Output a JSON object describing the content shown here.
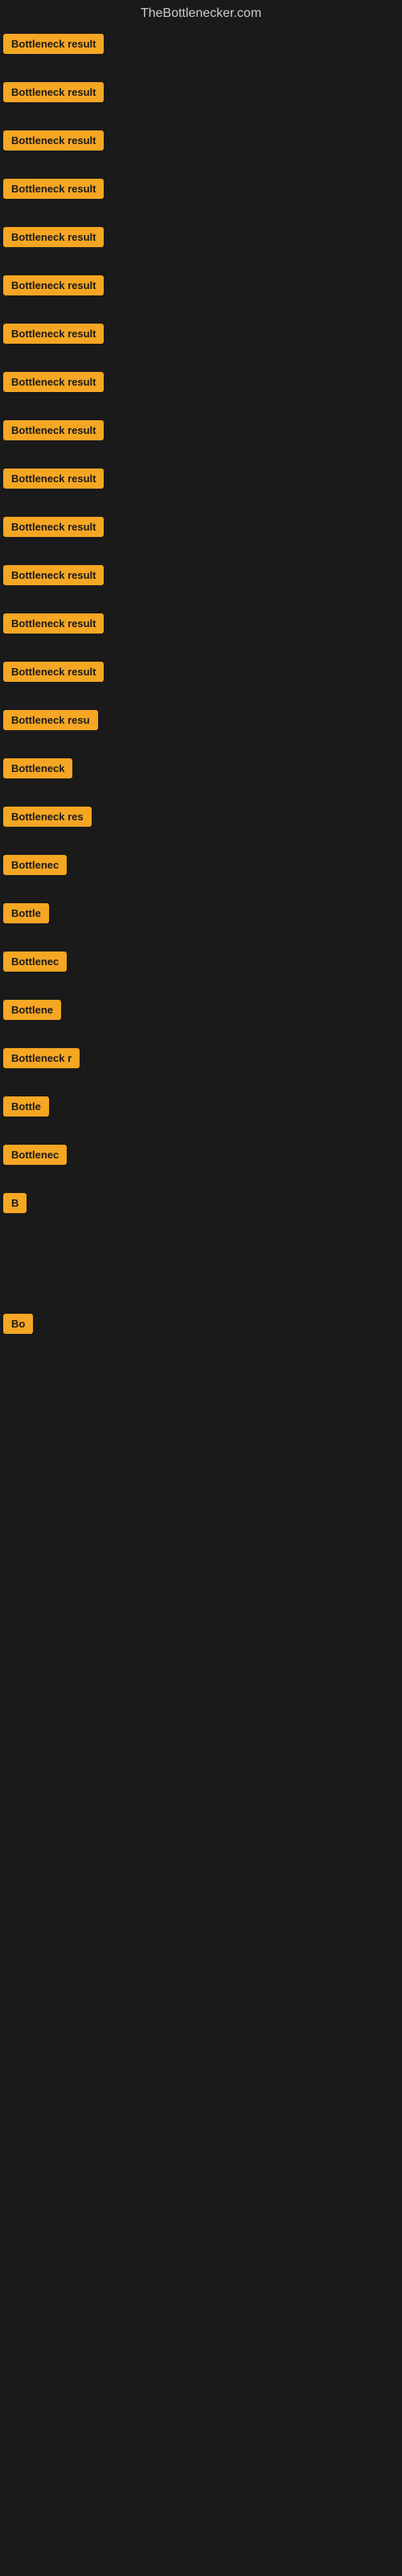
{
  "site": {
    "title": "TheBottlenecker.com"
  },
  "items": [
    {
      "id": 1,
      "label": "Bottleneck result",
      "width": 160
    },
    {
      "id": 2,
      "label": "Bottleneck result",
      "width": 160
    },
    {
      "id": 3,
      "label": "Bottleneck result",
      "width": 160
    },
    {
      "id": 4,
      "label": "Bottleneck result",
      "width": 160
    },
    {
      "id": 5,
      "label": "Bottleneck result",
      "width": 160
    },
    {
      "id": 6,
      "label": "Bottleneck result",
      "width": 160
    },
    {
      "id": 7,
      "label": "Bottleneck result",
      "width": 160
    },
    {
      "id": 8,
      "label": "Bottleneck result",
      "width": 160
    },
    {
      "id": 9,
      "label": "Bottleneck result",
      "width": 160
    },
    {
      "id": 10,
      "label": "Bottleneck result",
      "width": 160
    },
    {
      "id": 11,
      "label": "Bottleneck result",
      "width": 160
    },
    {
      "id": 12,
      "label": "Bottleneck result",
      "width": 160
    },
    {
      "id": 13,
      "label": "Bottleneck result",
      "width": 160
    },
    {
      "id": 14,
      "label": "Bottleneck result",
      "width": 160
    },
    {
      "id": 15,
      "label": "Bottleneck resu",
      "width": 130
    },
    {
      "id": 16,
      "label": "Bottleneck",
      "width": 90
    },
    {
      "id": 17,
      "label": "Bottleneck res",
      "width": 115
    },
    {
      "id": 18,
      "label": "Bottlenec",
      "width": 80
    },
    {
      "id": 19,
      "label": "Bottle",
      "width": 60
    },
    {
      "id": 20,
      "label": "Bottlenec",
      "width": 80
    },
    {
      "id": 21,
      "label": "Bottlene",
      "width": 72
    },
    {
      "id": 22,
      "label": "Bottleneck r",
      "width": 100
    },
    {
      "id": 23,
      "label": "Bottle",
      "width": 58
    },
    {
      "id": 24,
      "label": "Bottlenec",
      "width": 78
    },
    {
      "id": 25,
      "label": "B",
      "width": 20
    },
    {
      "id": 26,
      "label": "",
      "width": 0
    },
    {
      "id": 27,
      "label": "",
      "width": 0
    },
    {
      "id": 28,
      "label": "",
      "width": 0
    },
    {
      "id": 29,
      "label": "Bo",
      "width": 28
    },
    {
      "id": 30,
      "label": "",
      "width": 0
    },
    {
      "id": 31,
      "label": "",
      "width": 0
    },
    {
      "id": 32,
      "label": "",
      "width": 0
    }
  ],
  "badge_color": "#f5a623"
}
